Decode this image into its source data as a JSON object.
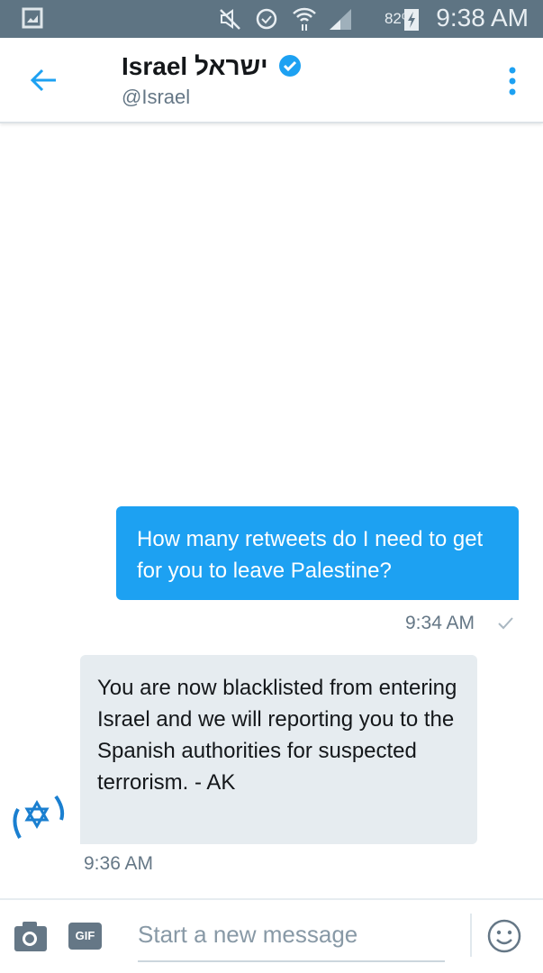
{
  "status_bar": {
    "battery": "82%",
    "time": "9:38 AM",
    "icons": [
      "gallery-icon",
      "mute-icon",
      "alarm-icon",
      "wifi-icon",
      "signal-icon",
      "battery-charging-icon"
    ]
  },
  "header": {
    "title": "Israel ישראל",
    "handle": "@Israel",
    "verified": true,
    "accent": "#1da1f2"
  },
  "messages": [
    {
      "direction": "sent",
      "text": "How many retweets do I need to get for you to leave Palestine?",
      "time": "9:34 AM",
      "status": "sent-check"
    },
    {
      "direction": "received",
      "text": "You are now blacklisted from entering Israel and we will reporting you to the Spanish authorities for suspected terrorism. - AK",
      "time": "9:36 AM"
    }
  ],
  "composer": {
    "placeholder": "Start a new message",
    "gif_label": "GIF"
  }
}
